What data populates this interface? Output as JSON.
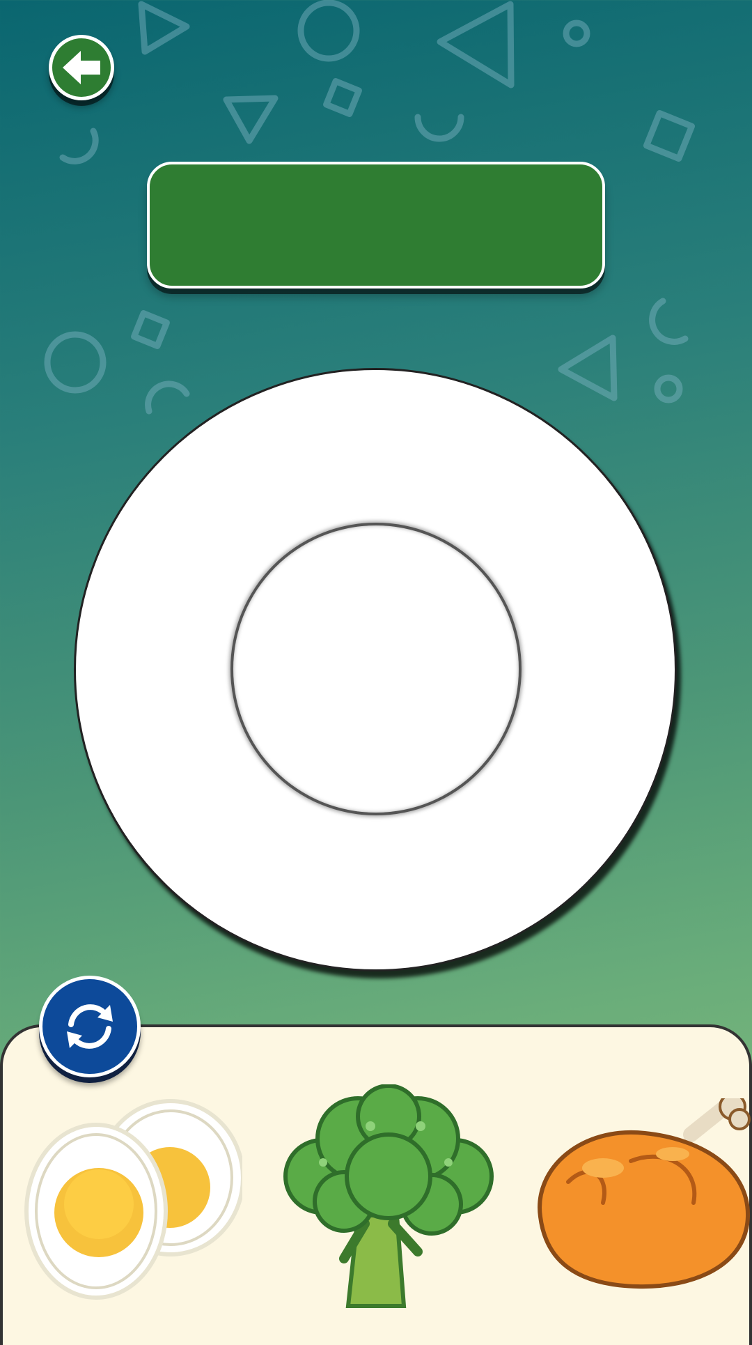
{
  "screen": {
    "background_colors": [
      "#0a6670",
      "#2a7f7a",
      "#4c9677",
      "#6aad7a",
      "#8cc27e"
    ]
  },
  "header": {
    "back_button_icon": "arrow-left-icon",
    "back_button_color": "#2e7d32",
    "title_bar_color": "#2f7d32",
    "title_text": ""
  },
  "plate": {
    "rim_color": "#ffffff",
    "center_color": "#ffffff"
  },
  "tray": {
    "background_color": "#fdf7e2",
    "refresh_button_icon": "refresh-arrows-icon",
    "refresh_button_color": "#0d4a9a",
    "foods": [
      {
        "name": "egg",
        "icon": "boiled-egg-icon"
      },
      {
        "name": "broccoli",
        "icon": "broccoli-icon"
      },
      {
        "name": "chicken",
        "icon": "roast-chicken-icon"
      }
    ]
  }
}
